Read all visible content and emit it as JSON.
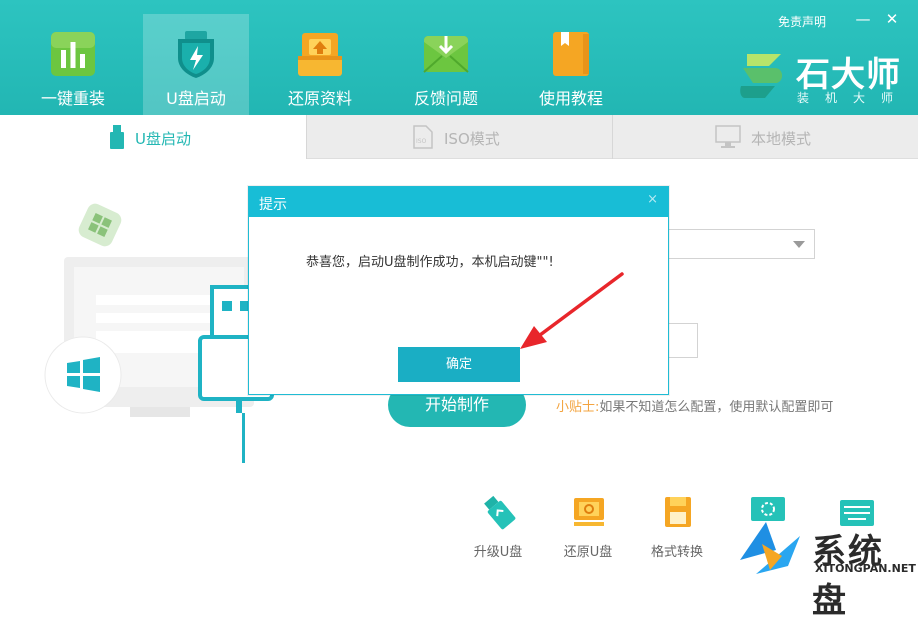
{
  "nav": {
    "items": [
      {
        "label": "一键重装",
        "icon": "bar-chart-icon"
      },
      {
        "label": "U盘启动",
        "icon": "usb-shield-icon",
        "active": true
      },
      {
        "label": "还原资料",
        "icon": "upload-box-icon"
      },
      {
        "label": "反馈问题",
        "icon": "mail-icon"
      },
      {
        "label": "使用教程",
        "icon": "book-icon"
      }
    ]
  },
  "header": {
    "disclaimer": "免责声明",
    "minimize_glyph": "—",
    "close_glyph": "✕",
    "brand_name": "石大师",
    "brand_sub": "装机大师"
  },
  "tabs": [
    {
      "label": "U盘启动",
      "icon": "usb-drive-icon",
      "active": true
    },
    {
      "label": "ISO模式",
      "icon": "iso-file-icon"
    },
    {
      "label": "本地模式",
      "icon": "monitor-icon"
    }
  ],
  "main": {
    "start_button": "开始制作",
    "hint_label": "小贴士:",
    "hint_text": "如果不知道怎么配置，使用默认配置即可"
  },
  "tools": [
    {
      "label": "升级U盘",
      "icon": "usb-upgrade-icon"
    },
    {
      "label": "还原U盘",
      "icon": "usb-restore-icon"
    },
    {
      "label": "格式转换",
      "icon": "floppy-icon"
    }
  ],
  "dialog": {
    "title": "提示",
    "close_glyph": "×",
    "message": "恭喜您，启动U盘制作成功，本机启动键\"\"!",
    "ok_button": "确定"
  },
  "watermark": {
    "text": "系统盘",
    "url": "XITONGPAN.NET"
  },
  "colors": {
    "accent": "#23b7b3",
    "dialog_title": "#18bdd6",
    "ok_button": "#1aaec4",
    "hint_label": "#f3a440",
    "annotation_arrow": "#e8262b"
  }
}
